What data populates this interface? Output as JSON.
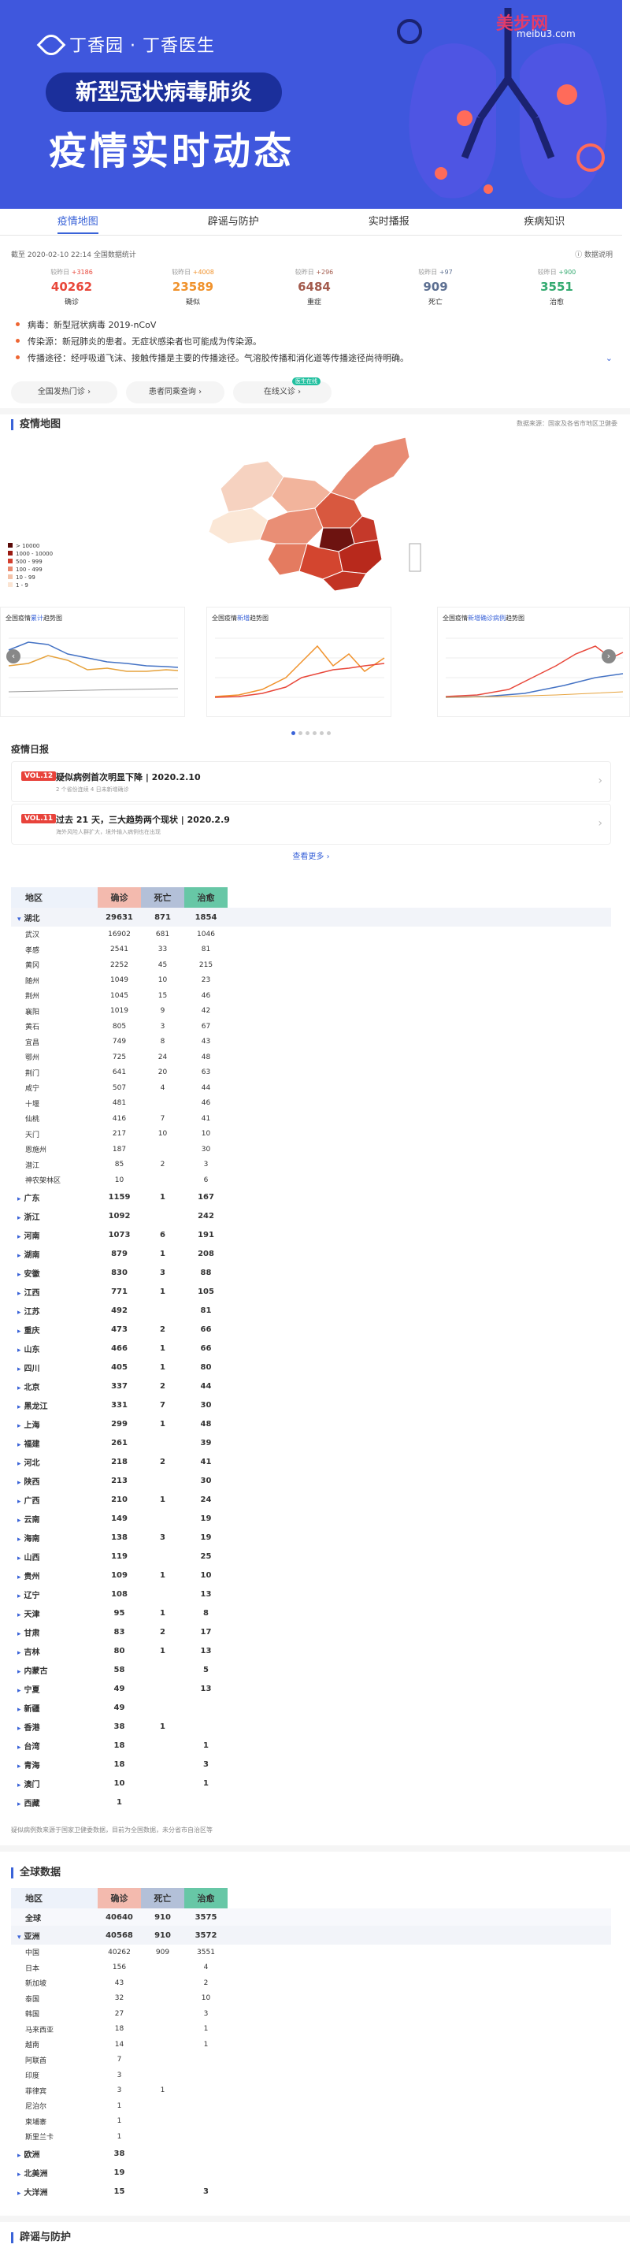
{
  "banner": {
    "brand": "丁香园 · 丁香医生",
    "pill": "新型冠状病毒肺炎",
    "headline": "疫情实时动态",
    "watermark": "美步网",
    "watermark_sub": "meibu3.com"
  },
  "tabs": [
    "疫情地图",
    "辟谣与防护",
    "实时播报",
    "疾病知识"
  ],
  "summary": {
    "time": "截至 2020-02-10 22:14 全国数据统计",
    "source_link": "数据说明",
    "stats": [
      {
        "delta_label": "较昨日",
        "delta": "+3186",
        "value": "40262",
        "label": "确诊",
        "color": "#e8473a"
      },
      {
        "delta_label": "较昨日",
        "delta": "+4008",
        "value": "23589",
        "label": "疑似",
        "color": "#f0922c"
      },
      {
        "delta_label": "较昨日",
        "delta": "+296",
        "value": "6484",
        "label": "重症",
        "color": "#a35b4d"
      },
      {
        "delta_label": "较昨日",
        "delta": "+97",
        "value": "909",
        "label": "死亡",
        "color": "#5d7092"
      },
      {
        "delta_label": "较昨日",
        "delta": "+900",
        "value": "3551",
        "label": "治愈",
        "color": "#34aa70"
      }
    ]
  },
  "notes": [
    "病毒：新型冠状病毒 2019-nCoV",
    "传染源：新冠肺炎的患者。无症状感染者也可能成为传染源。",
    "传播途径：经呼吸道飞沫、接触传播是主要的传播途径。气溶胶传播和消化道等传播途径尚待明确。"
  ],
  "buttons": {
    "b1": "全国发热门诊",
    "b2": "患者同乘查询",
    "b3": "在线义诊",
    "b3_tag": "医生在线"
  },
  "map_section": {
    "title": "疫情地图",
    "source": "数据来源：国家及各省市地区卫健委",
    "legend": [
      "> 10000",
      "1000 - 10000",
      "500 - 999",
      "100 - 499",
      "10 - 99",
      "1 - 9"
    ]
  },
  "charts": {
    "c1": {
      "pre": "全国疫情",
      "hl": "累计",
      "post": "趋势图"
    },
    "c2": {
      "pre": "全国疫情",
      "hl": "新增",
      "post": "趋势图"
    },
    "c3": {
      "pre": "全国疫情",
      "hl": "新增确诊病例",
      "post": "趋势图"
    }
  },
  "daily": {
    "title": "疫情日报",
    "items": [
      {
        "tag": "VOL.12",
        "headline": "疑似病例首次明显下降 | 2020.2.10",
        "sub": "2 个省份连续 4 日未新增确诊"
      },
      {
        "tag": "VOL.11",
        "headline": "过去 21 天，三大趋势两个现状 | 2020.2.9",
        "sub": "海外风险人群扩大，境外输入病例也在出现"
      }
    ],
    "more": "查看更多 ›"
  },
  "china_table": {
    "headers": {
      "region": "地区",
      "confirmed": "确诊",
      "dead": "死亡",
      "cured": "治愈"
    },
    "hubei": {
      "name": "湖北",
      "confirmed": "29631",
      "dead": "871",
      "cured": "1854"
    },
    "hubei_cities": [
      [
        "武汉",
        "16902",
        "681",
        "1046"
      ],
      [
        "孝感",
        "2541",
        "33",
        "81"
      ],
      [
        "黄冈",
        "2252",
        "45",
        "215"
      ],
      [
        "随州",
        "1049",
        "10",
        "23"
      ],
      [
        "荆州",
        "1045",
        "15",
        "46"
      ],
      [
        "襄阳",
        "1019",
        "9",
        "42"
      ],
      [
        "黄石",
        "805",
        "3",
        "67"
      ],
      [
        "宜昌",
        "749",
        "8",
        "43"
      ],
      [
        "鄂州",
        "725",
        "24",
        "48"
      ],
      [
        "荆门",
        "641",
        "20",
        "63"
      ],
      [
        "咸宁",
        "507",
        "4",
        "44"
      ],
      [
        "十堰",
        "481",
        "",
        "46"
      ],
      [
        "仙桃",
        "416",
        "7",
        "41"
      ],
      [
        "天门",
        "217",
        "10",
        "10"
      ],
      [
        "恩施州",
        "187",
        "",
        "30"
      ],
      [
        "潜江",
        "85",
        "2",
        "3"
      ],
      [
        "神农架林区",
        "10",
        "",
        "6"
      ]
    ],
    "provinces": [
      [
        "广东",
        "1159",
        "1",
        "167"
      ],
      [
        "浙江",
        "1092",
        "",
        "242"
      ],
      [
        "河南",
        "1073",
        "6",
        "191"
      ],
      [
        "湖南",
        "879",
        "1",
        "208"
      ],
      [
        "安徽",
        "830",
        "3",
        "88"
      ],
      [
        "江西",
        "771",
        "1",
        "105"
      ],
      [
        "江苏",
        "492",
        "",
        "81"
      ],
      [
        "重庆",
        "473",
        "2",
        "66"
      ],
      [
        "山东",
        "466",
        "1",
        "66"
      ],
      [
        "四川",
        "405",
        "1",
        "80"
      ],
      [
        "北京",
        "337",
        "2",
        "44"
      ],
      [
        "黑龙江",
        "331",
        "7",
        "30"
      ],
      [
        "上海",
        "299",
        "1",
        "48"
      ],
      [
        "福建",
        "261",
        "",
        "39"
      ],
      [
        "河北",
        "218",
        "2",
        "41"
      ],
      [
        "陕西",
        "213",
        "",
        "30"
      ],
      [
        "广西",
        "210",
        "1",
        "24"
      ],
      [
        "云南",
        "149",
        "",
        "19"
      ],
      [
        "海南",
        "138",
        "3",
        "19"
      ],
      [
        "山西",
        "119",
        "",
        "25"
      ],
      [
        "贵州",
        "109",
        "1",
        "10"
      ],
      [
        "辽宁",
        "108",
        "",
        "13"
      ],
      [
        "天津",
        "95",
        "1",
        "8"
      ],
      [
        "甘肃",
        "83",
        "2",
        "17"
      ],
      [
        "吉林",
        "80",
        "1",
        "13"
      ],
      [
        "内蒙古",
        "58",
        "",
        "5"
      ],
      [
        "宁夏",
        "49",
        "",
        "13"
      ],
      [
        "新疆",
        "49",
        "",
        ""
      ],
      [
        "香港",
        "38",
        "1",
        ""
      ],
      [
        "台湾",
        "18",
        "",
        "1"
      ],
      [
        "青海",
        "18",
        "",
        "3"
      ],
      [
        "澳门",
        "10",
        "",
        "1"
      ],
      [
        "西藏",
        "1",
        "",
        ""
      ]
    ],
    "footnote": "疑似病例数来源于国家卫健委数据，目前为全国数据，未分省市自治区等"
  },
  "global_table": {
    "title": "全球数据",
    "total": {
      "name": "全球",
      "confirmed": "40640",
      "dead": "910",
      "cured": "3575"
    },
    "asia": {
      "name": "亚洲",
      "confirmed": "40568",
      "dead": "910",
      "cured": "3572"
    },
    "asia_countries": [
      [
        "中国",
        "40262",
        "909",
        "3551"
      ],
      [
        "日本",
        "156",
        "",
        "4"
      ],
      [
        "新加坡",
        "43",
        "",
        "2"
      ],
      [
        "泰国",
        "32",
        "",
        "10"
      ],
      [
        "韩国",
        "27",
        "",
        "3"
      ],
      [
        "马来西亚",
        "18",
        "",
        "1"
      ],
      [
        "越南",
        "14",
        "",
        "1"
      ],
      [
        "阿联酋",
        "7",
        "",
        ""
      ],
      [
        "印度",
        "3",
        "",
        ""
      ],
      [
        "菲律宾",
        "3",
        "1",
        ""
      ],
      [
        "尼泊尔",
        "1",
        "",
        ""
      ],
      [
        "柬埔寨",
        "1",
        "",
        ""
      ],
      [
        "斯里兰卡",
        "1",
        "",
        ""
      ]
    ],
    "continents": [
      [
        "欧洲",
        "38",
        "",
        ""
      ],
      [
        "北美洲",
        "19",
        "",
        ""
      ],
      [
        "大洋洲",
        "15",
        "",
        "3"
      ]
    ]
  },
  "bottom": {
    "title": "辟谣与防护"
  }
}
